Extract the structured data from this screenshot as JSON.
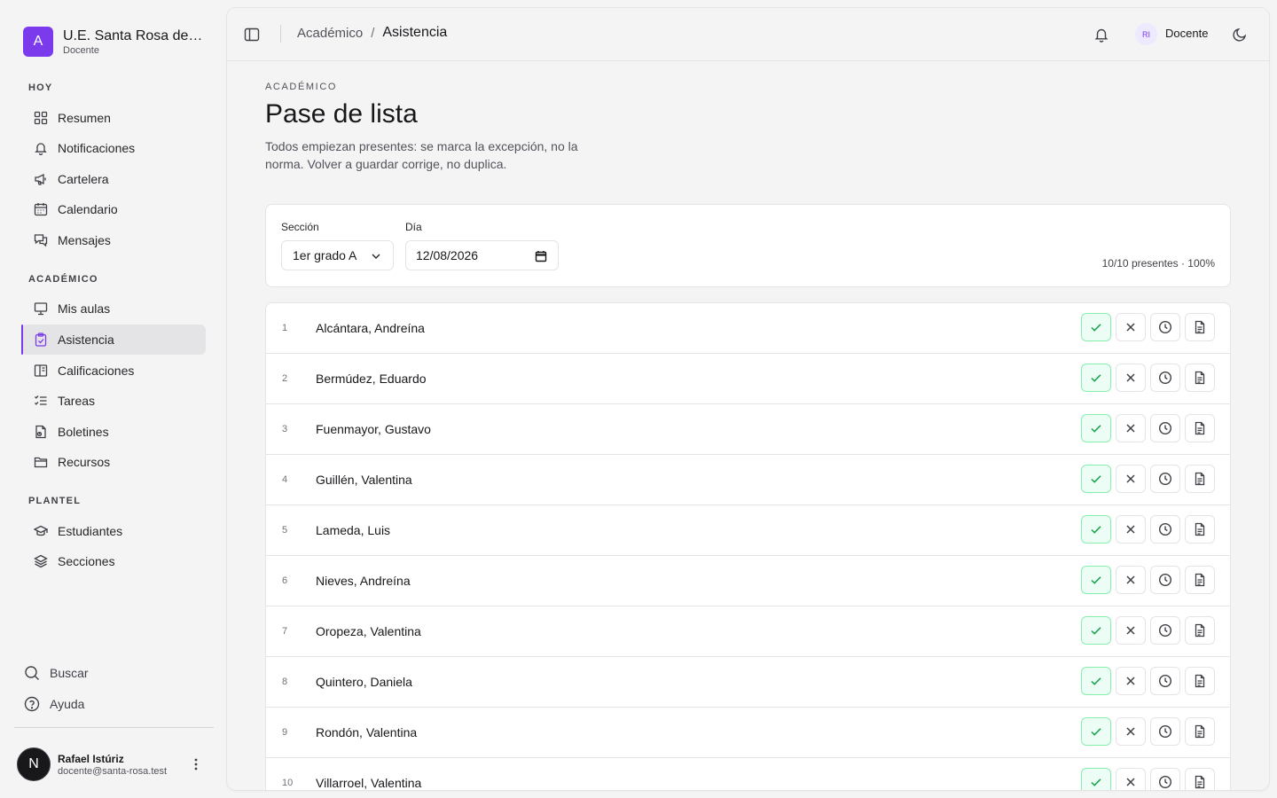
{
  "brand": {
    "logo_letter": "A",
    "name": "U.E. Santa Rosa de Li...",
    "role": "Docente"
  },
  "nav": {
    "groups": [
      {
        "label": "HOY",
        "items": [
          {
            "label": "Resumen",
            "icon": "grid-icon"
          },
          {
            "label": "Notificaciones",
            "icon": "bell-icon"
          },
          {
            "label": "Cartelera",
            "icon": "megaphone-icon"
          },
          {
            "label": "Calendario",
            "icon": "calendar-icon"
          },
          {
            "label": "Mensajes",
            "icon": "messages-icon"
          }
        ]
      },
      {
        "label": "ACADÉMICO",
        "items": [
          {
            "label": "Mis aulas",
            "icon": "presentation-icon"
          },
          {
            "label": "Asistencia",
            "icon": "clipboard-check-icon",
            "active": true
          },
          {
            "label": "Calificaciones",
            "icon": "book-icon"
          },
          {
            "label": "Tareas",
            "icon": "list-check-icon"
          },
          {
            "label": "Boletines",
            "icon": "file-report-icon"
          },
          {
            "label": "Recursos",
            "icon": "folder-icon"
          }
        ]
      },
      {
        "label": "PLANTEL",
        "items": [
          {
            "label": "Estudiantes",
            "icon": "graduation-cap-icon"
          },
          {
            "label": "Secciones",
            "icon": "layers-icon"
          }
        ]
      }
    ],
    "utility": [
      {
        "label": "Buscar",
        "icon": "search-icon"
      },
      {
        "label": "Ayuda",
        "icon": "help-icon"
      }
    ]
  },
  "user": {
    "initial": "N",
    "name": "Rafael Istúriz",
    "email": "docente@santa-rosa.test"
  },
  "topbar": {
    "breadcrumb_parent": "Académico",
    "breadcrumb_sep": "/",
    "breadcrumb_current": "Asistencia",
    "avatar_initials": "RI",
    "role": "Docente"
  },
  "page": {
    "eyebrow": "ACADÉMICO",
    "title": "Pase de lista",
    "description": "Todos empiezan presentes: se marca la excepción, no la norma. Volver a guardar corrige, no duplica."
  },
  "filters": {
    "section_label": "Sección",
    "section_value": "1er grado A",
    "day_label": "Día",
    "day_value": "12/08/2026",
    "summary": "10/10 presentes · 100%"
  },
  "students": [
    {
      "num": "1",
      "name": "Alcántara, Andreína",
      "status": "present"
    },
    {
      "num": "2",
      "name": "Bermúdez, Eduardo",
      "status": "present"
    },
    {
      "num": "3",
      "name": "Fuenmayor, Gustavo",
      "status": "present"
    },
    {
      "num": "4",
      "name": "Guillén, Valentina",
      "status": "present"
    },
    {
      "num": "5",
      "name": "Lameda, Luis",
      "status": "present"
    },
    {
      "num": "6",
      "name": "Nieves, Andreína",
      "status": "present"
    },
    {
      "num": "7",
      "name": "Oropeza, Valentina",
      "status": "present"
    },
    {
      "num": "8",
      "name": "Quintero, Daniela",
      "status": "present"
    },
    {
      "num": "9",
      "name": "Rondón, Valentina",
      "status": "present"
    },
    {
      "num": "10",
      "name": "Villarroel, Valentina",
      "status": "present"
    }
  ],
  "colors": {
    "accent": "#7c3aed",
    "present": "#16a34a"
  }
}
